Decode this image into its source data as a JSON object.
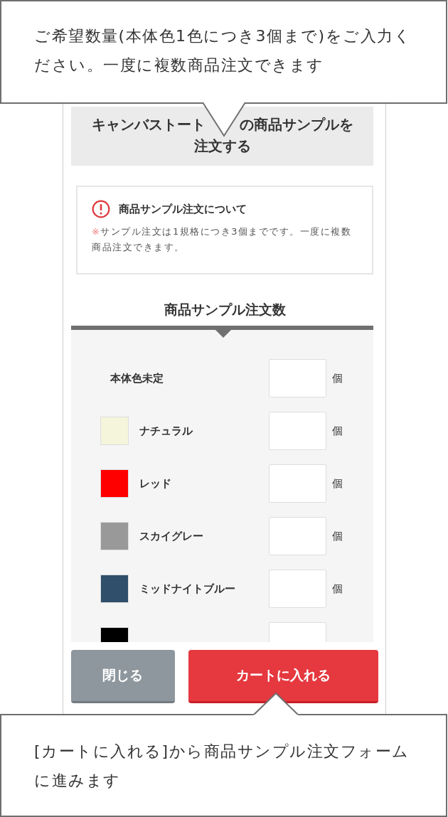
{
  "top_callout": {
    "text": "ご希望数量(本体色1色につき3個まで)をご入力ください。一度に複数商品注文できます"
  },
  "title": {
    "part_1": "キャンバストート",
    "part_2": "の商品サンプルを",
    "part_3": "注文する"
  },
  "notice": {
    "heading": "商品サンプル注文について",
    "mark": "※",
    "text": "サンプル注文は1規格につき3個までです。一度に複数商品注文できます。"
  },
  "section_heading": "商品サンプル注文数",
  "rows": [
    {
      "kind": "unset",
      "name": "本体色未定",
      "unit": "個"
    },
    {
      "kind": "swatch",
      "color": "#f5f5dc",
      "name": "ナチュラル",
      "unit": "個"
    },
    {
      "kind": "swatch",
      "color": "#ff0000",
      "name": "レッド",
      "unit": "個"
    },
    {
      "kind": "swatch",
      "color": "#999999",
      "name": "スカイグレー",
      "unit": "個"
    },
    {
      "kind": "swatch",
      "color": "#2f4f6b",
      "name": "ミッドナイトブルー",
      "unit": "個"
    },
    {
      "kind": "swatch",
      "color": "#000000"
    }
  ],
  "buttons": [
    {
      "kind": "secondary",
      "label": "閉じる"
    },
    {
      "kind": "primary",
      "label": "カートに入れる"
    }
  ],
  "bottom_callout": {
    "text": "[カートに入れる]から商品サンプル注文フォームに進みます"
  }
}
